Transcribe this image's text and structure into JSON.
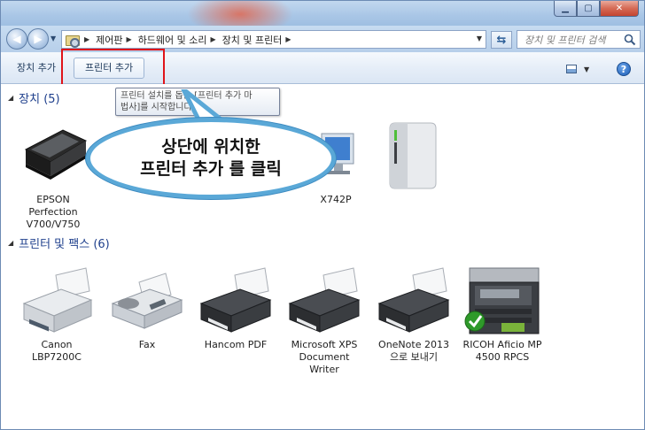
{
  "window": {
    "controls": {
      "minimize": "▁",
      "maximize": "▢",
      "close": "✕"
    }
  },
  "address": {
    "back_icon": "back-arrow-icon",
    "forward_icon": "forward-arrow-icon",
    "breadcrumbs": [
      "제어판",
      "하드웨어 및 소리",
      "장치 및 프린터"
    ],
    "search_placeholder": "장치 및 프린터 검색"
  },
  "toolbar": {
    "add_device": "장치 추가",
    "add_printer": "프린터 추가"
  },
  "tooltip": {
    "line1": "프린터 설치를 돕는 [프린터 추가 마",
    "line2": "법사]를 시작합니다."
  },
  "callout": {
    "line1": "상단에 위치한",
    "line2": "프린터 추가 를 클릭"
  },
  "groups": {
    "devices": {
      "header": "장치 (5)",
      "items": [
        {
          "label": "EPSON Perfection V700/V750",
          "icon": "scanner-icon"
        },
        {
          "label": "X742P",
          "icon": "monitor-icon"
        },
        {
          "label": "",
          "icon": "external-drive-icon"
        }
      ]
    },
    "printers": {
      "header": "프린터 및 팩스 (6)",
      "items": [
        {
          "label": "Canon LBP7200C",
          "icon": "printer-icon"
        },
        {
          "label": "Fax",
          "icon": "fax-icon"
        },
        {
          "label": "Hancom PDF",
          "icon": "printer-icon"
        },
        {
          "label": "Microsoft XPS Document Writer",
          "icon": "printer-icon"
        },
        {
          "label": "OneNote 2013으로 보내기",
          "icon": "printer-icon"
        },
        {
          "label": "RICOH Aficio MP 4500 RPCS",
          "icon": "mfp-printer-icon",
          "default": true
        }
      ]
    }
  },
  "colors": {
    "highlight": "#e0141a",
    "callout_border": "#5aa8d7",
    "group_header": "#1e3f8c"
  }
}
